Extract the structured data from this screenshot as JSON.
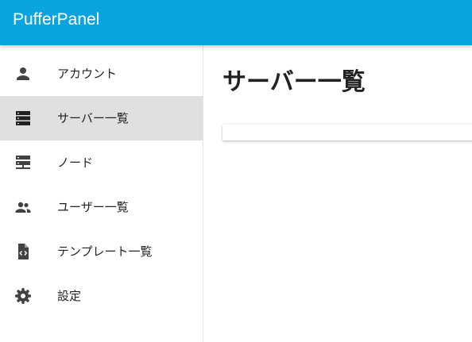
{
  "app": {
    "title": "PufferPanel"
  },
  "sidebar": {
    "items": [
      {
        "label": "アカウント",
        "icon": "account-icon",
        "active": false
      },
      {
        "label": "サーバー一覧",
        "icon": "server-icon",
        "active": true
      },
      {
        "label": "ノード",
        "icon": "node-icon",
        "active": false
      },
      {
        "label": "ユーザー一覧",
        "icon": "users-icon",
        "active": false
      },
      {
        "label": "テンプレート一覧",
        "icon": "template-file-icon",
        "active": false
      },
      {
        "label": "設定",
        "icon": "gear-icon",
        "active": false
      }
    ]
  },
  "main": {
    "title": "サーバー一覧"
  },
  "colors": {
    "appbar": "#0aa5e0",
    "active_item": "#e0e0e0",
    "icon": "#424242"
  }
}
